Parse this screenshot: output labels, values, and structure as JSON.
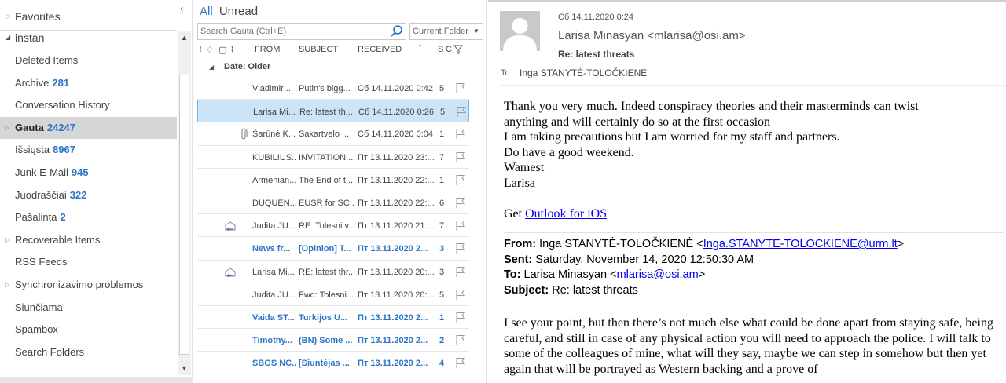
{
  "folders": {
    "favorites_label": "Favorites",
    "account_label": "instan",
    "items": [
      {
        "label": "Deleted Items",
        "count": "",
        "expandable": false,
        "selected": false
      },
      {
        "label": "Archive",
        "count": "281",
        "expandable": false,
        "selected": false
      },
      {
        "label": "Conversation History",
        "count": "",
        "expandable": false,
        "selected": false
      },
      {
        "label": "Gauta",
        "count": "24247",
        "expandable": true,
        "selected": true
      },
      {
        "label": "Išsiųsta",
        "count": "8967",
        "expandable": false,
        "selected": false
      },
      {
        "label": "Junk E-Mail",
        "count": "945",
        "expandable": false,
        "selected": false
      },
      {
        "label": "Juodraščiai",
        "count": "322",
        "expandable": false,
        "selected": false
      },
      {
        "label": "Pašalinta",
        "count": "2",
        "expandable": false,
        "selected": false
      },
      {
        "label": "Recoverable Items",
        "count": "",
        "expandable": true,
        "selected": false
      },
      {
        "label": "RSS Feeds",
        "count": "",
        "expandable": false,
        "selected": false
      },
      {
        "label": "Synchronizavimo problemos",
        "count": "",
        "expandable": true,
        "selected": false
      },
      {
        "label": "Siunčiama",
        "count": "",
        "expandable": false,
        "selected": false
      },
      {
        "label": "Spambox",
        "count": "",
        "expandable": false,
        "selected": false
      },
      {
        "label": "Search Folders",
        "count": "",
        "expandable": false,
        "selected": false
      }
    ]
  },
  "message_list": {
    "filter_all": "All",
    "filter_unread": "Unread",
    "search_placeholder": "Search Gauta (Ctrl+E)",
    "scope": "Current Folder",
    "columns": {
      "from": "FROM",
      "subject": "SUBJECT",
      "received": "RECEIVED",
      "size": "S",
      "cat": "C"
    },
    "group": "Date: Older",
    "rows": [
      {
        "from": "Vladimir ...",
        "subject": "Putin's bigg...",
        "received": "Сб 14.11.2020 0:42",
        "size": "5",
        "unread": false,
        "selected": false,
        "replied": false,
        "attach": false
      },
      {
        "from": "Larisa Mi...",
        "subject": "Re:  latest th...",
        "received": "Сб 14.11.2020 0:26",
        "size": "5",
        "unread": false,
        "selected": true,
        "replied": false,
        "attach": false
      },
      {
        "from": "Šarūnė K...",
        "subject": "Sakartvelo ...",
        "received": "Сб 14.11.2020 0:04",
        "size": "1",
        "unread": false,
        "selected": false,
        "replied": false,
        "attach": true
      },
      {
        "from": "KUBILIUS...",
        "subject": "INVITATION...",
        "received": "Пт 13.11.2020 23:...",
        "size": "7",
        "unread": false,
        "selected": false,
        "replied": false,
        "attach": false
      },
      {
        "from": "Armenian...",
        "subject": "The End of t...",
        "received": "Пт 13.11.2020 22:...",
        "size": "1",
        "unread": false,
        "selected": false,
        "replied": false,
        "attach": false
      },
      {
        "from": "DUQUEN...",
        "subject": "EUSR for SC ...",
        "received": "Пт 13.11.2020 22:...",
        "size": "6",
        "unread": false,
        "selected": false,
        "replied": false,
        "attach": false
      },
      {
        "from": "Judita JU...",
        "subject": "RE: Tolesni v...",
        "received": "Пт 13.11.2020 21:...",
        "size": "7",
        "unread": false,
        "selected": false,
        "replied": true,
        "attach": false
      },
      {
        "from": "News fr...",
        "subject": "[Opinion] T...",
        "received": "Пт 13.11.2020 2...",
        "size": "3",
        "unread": true,
        "selected": false,
        "replied": false,
        "attach": false
      },
      {
        "from": "Larisa Mi...",
        "subject": "RE: latest thr...",
        "received": "Пт 13.11.2020 20:...",
        "size": "3",
        "unread": false,
        "selected": false,
        "replied": true,
        "attach": false
      },
      {
        "from": "Judita JU...",
        "subject": "Fwd: Tolesni...",
        "received": "Пт 13.11.2020 20:...",
        "size": "5",
        "unread": false,
        "selected": false,
        "replied": false,
        "attach": false
      },
      {
        "from": "Vaida ST...",
        "subject": "Turkijos U...",
        "received": "Пт 13.11.2020 2...",
        "size": "1",
        "unread": true,
        "selected": false,
        "replied": false,
        "attach": false
      },
      {
        "from": "Timothy...",
        "subject": "(BN) Some ...",
        "received": "Пт 13.11.2020 2...",
        "size": "2",
        "unread": true,
        "selected": false,
        "replied": false,
        "attach": false
      },
      {
        "from": "SBGS NC...",
        "subject": "[Siuntėjas ...",
        "received": "Пт 13.11.2020 2...",
        "size": "4",
        "unread": true,
        "selected": false,
        "replied": false,
        "attach": false
      }
    ]
  },
  "reading": {
    "date": "Сб 14.11.2020 0:24",
    "sender": "Larisa Minasyan <mlarisa@osi.am>",
    "subject": "Re:  latest threats",
    "to_label": "To",
    "to": "Inga STANYTĖ-TOLOČKIENĖ",
    "body_lines": [
      "Thank you very much. Indeed conspiracy theories and their masterminds can twist",
      "anything and will certainly do so at the first occasion",
      "I am taking precautions but I am worried for my staff and partners.",
      "Do have a good weekend.",
      "Wamest",
      "Larisa"
    ],
    "get_text": "Get",
    "get_link": "Outlook for iOS",
    "quote": {
      "from_label": "From:",
      "from_name": "Inga STANYTĖ-TOLOČKIENĖ <",
      "from_email": "Inga.STANYTE-TOLOCKIENE@urm.lt",
      "from_close": ">",
      "sent_label": "Sent:",
      "sent": "Saturday, November 14, 2020 12:50:30 AM",
      "to_label": "To:",
      "to_name": "Larisa Minasyan <",
      "to_email": "mlarisa@osi.am",
      "to_close": ">",
      "subject_label": "Subject:",
      "subject": "Re: latest threats"
    },
    "quote_body": "I see your point, but then there’s not much else what could be done apart from staying safe, being careful, and still in case of any physical action you will need to approach the police. I will talk to some of the colleagues of mine, what will they say, maybe we can step in somehow but then yet again that will be portrayed as Western backing and a prove of"
  }
}
